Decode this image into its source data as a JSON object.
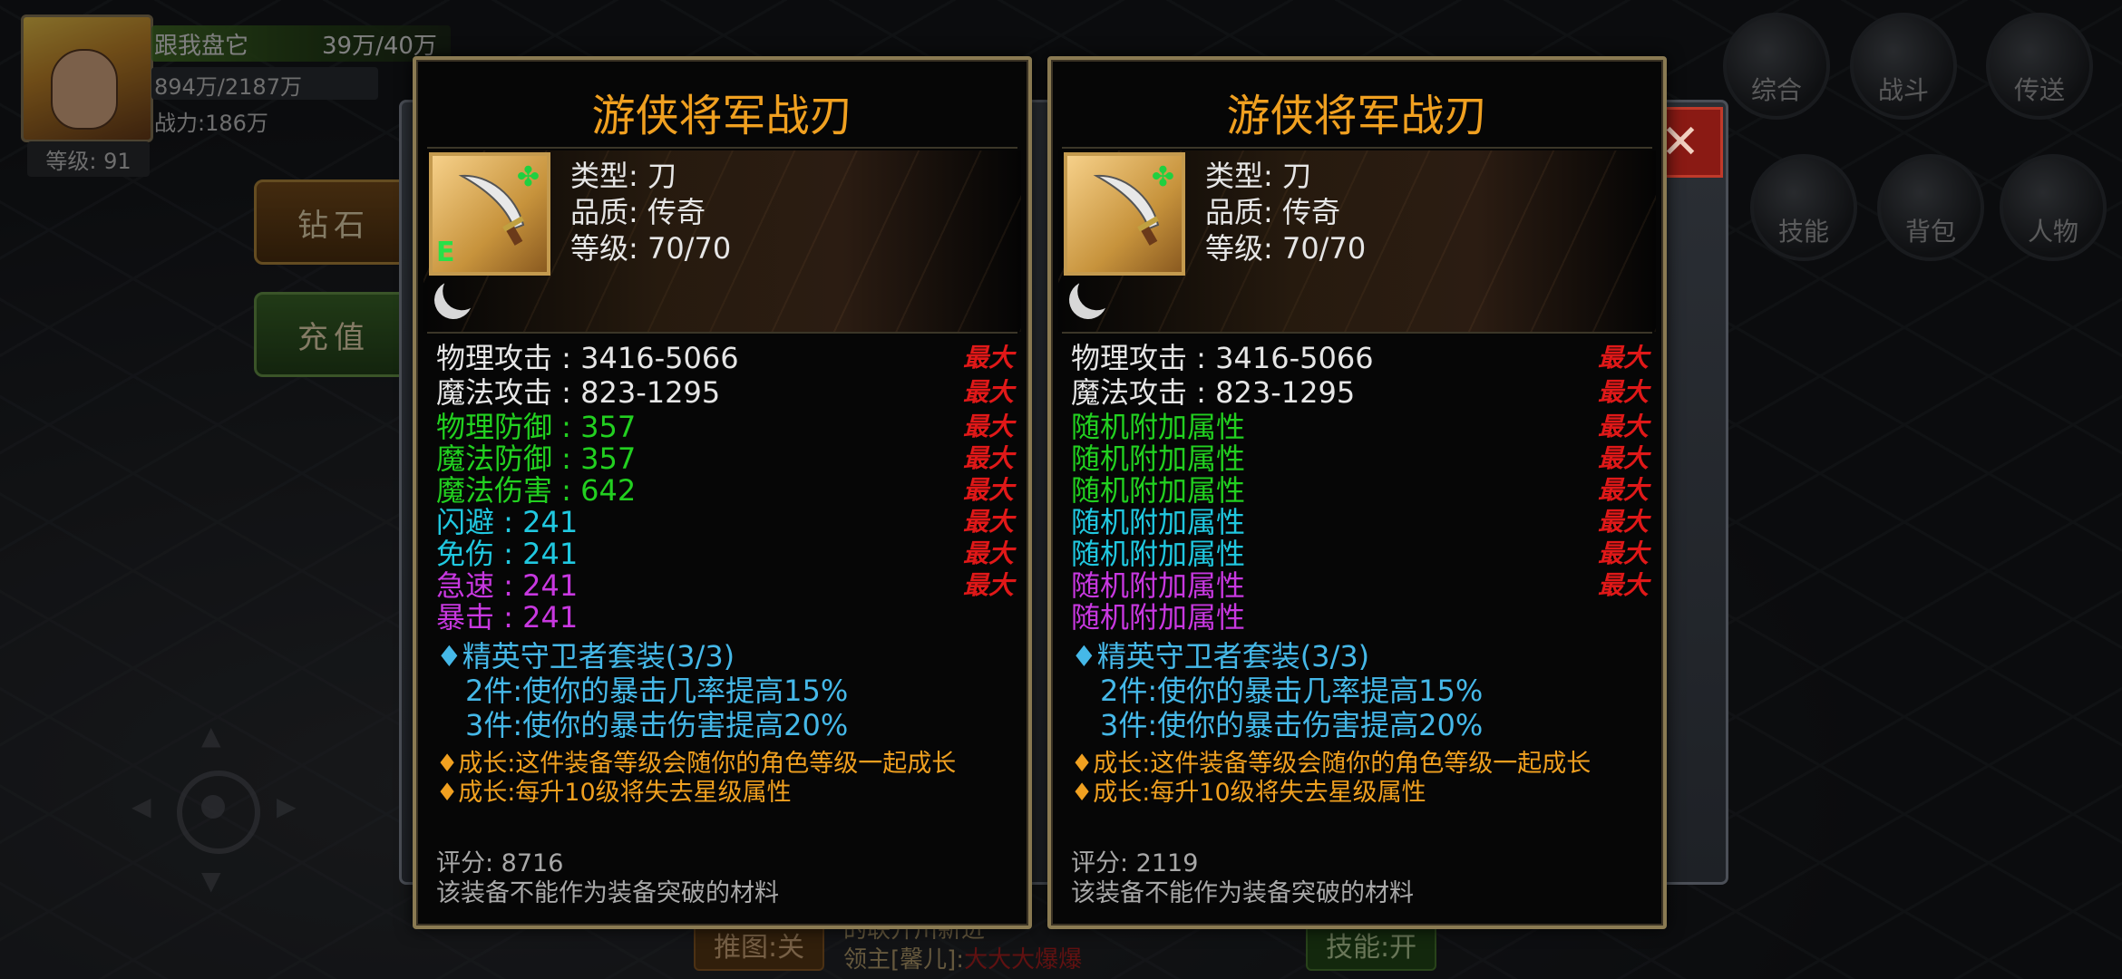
{
  "hud": {
    "name": "跟我盘它",
    "hp": "39万/40万",
    "exp": "894万/2187万",
    "power": "战力:186万",
    "level": "等级: 91"
  },
  "side_buttons": {
    "diamond": "钻石",
    "recharge": "充值"
  },
  "right_menu": {
    "comprehensive": "综合",
    "battle": "战斗",
    "teleport": "传送",
    "skill": "技能",
    "bag": "背包",
    "character": "人物"
  },
  "bottom": {
    "map_button": "推图:关",
    "skill_button": "技能:开",
    "log_line1": "的联开川新进",
    "log_line2_prefix": "领主[馨儿]:",
    "log_line2_red": "大大大爆爆"
  },
  "close_icon": "close-icon",
  "cards": [
    {
      "title": "游侠将军战刃",
      "badge": "E",
      "type": "类型: 刀",
      "quality": "品质: 传奇",
      "level": "等级: 70/70",
      "stats": [
        {
          "text": "物理攻击 : 3416-5066",
          "color": "white",
          "max": "最大"
        },
        {
          "text": "魔法攻击 : 823-1295",
          "color": "white",
          "max": "最大"
        },
        {
          "text": "物理防御 : 357",
          "color": "green",
          "max": "最大"
        },
        {
          "text": "魔法防御 : 357",
          "color": "green",
          "max": "最大"
        },
        {
          "text": "魔法伤害 : 642",
          "color": "green",
          "max": "最大"
        },
        {
          "text": "闪避 : 241",
          "color": "cyan",
          "max": "最大"
        },
        {
          "text": "免伤 : 241",
          "color": "cyan",
          "max": "最大"
        },
        {
          "text": "急速 : 241",
          "color": "purple",
          "max": "最大"
        },
        {
          "text": "暴击 : 241",
          "color": "purple",
          "max": ""
        }
      ],
      "set_name": "♦精英守卫者套装(3/3)",
      "set_bonus": [
        "2件:使你的暴击几率提高15%",
        "3件:使你的暴击伤害提高20%"
      ],
      "growth": [
        "♦成长:这件装备等级会随你的角色等级一起成长",
        "♦成长:每升10级将失去星级属性"
      ],
      "score": "评分: 8716",
      "note": "该装备不能作为装备突破的材料"
    },
    {
      "title": "游侠将军战刃",
      "badge": "",
      "type": "类型: 刀",
      "quality": "品质: 传奇",
      "level": "等级: 70/70",
      "stats": [
        {
          "text": "物理攻击 : 3416-5066",
          "color": "white",
          "max": "最大"
        },
        {
          "text": "魔法攻击 : 823-1295",
          "color": "white",
          "max": "最大"
        },
        {
          "text": "随机附加属性",
          "color": "green",
          "max": "最大"
        },
        {
          "text": "随机附加属性",
          "color": "green",
          "max": "最大"
        },
        {
          "text": "随机附加属性",
          "color": "green",
          "max": "最大"
        },
        {
          "text": "随机附加属性",
          "color": "cyan",
          "max": "最大"
        },
        {
          "text": "随机附加属性",
          "color": "cyan",
          "max": "最大"
        },
        {
          "text": "随机附加属性",
          "color": "purple",
          "max": "最大"
        },
        {
          "text": "随机附加属性",
          "color": "purple",
          "max": ""
        }
      ],
      "set_name": "♦精英守卫者套装(3/3)",
      "set_bonus": [
        "2件:使你的暴击几率提高15%",
        "3件:使你的暴击伤害提高20%"
      ],
      "growth": [
        "♦成长:这件装备等级会随你的角色等级一起成长",
        "♦成长:每升10级将失去星级属性"
      ],
      "score": "评分: 2119",
      "note": "该装备不能作为装备突破的材料"
    }
  ],
  "colors": {
    "title": "#f0a020",
    "white": "#e6e6e6",
    "green": "#22d020",
    "cyan": "#20c8e0",
    "purple": "#c838e0",
    "set": "#45b8e8",
    "growth": "#f0a020",
    "max": "#e01818"
  }
}
